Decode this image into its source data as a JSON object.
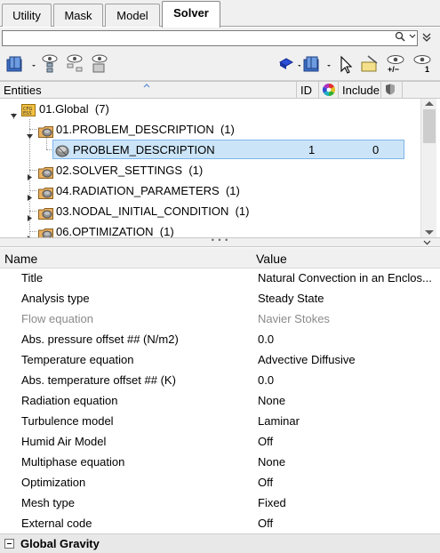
{
  "tabs": [
    {
      "label": "Utility",
      "active": false
    },
    {
      "label": "Mask",
      "active": false
    },
    {
      "label": "Model",
      "active": false
    },
    {
      "label": "Solver",
      "active": true
    }
  ],
  "search": {
    "value": "",
    "placeholder": ""
  },
  "entities_header": {
    "entities": "Entities",
    "id": "ID",
    "include": "Include"
  },
  "tree": [
    {
      "label": "01.Global",
      "count": "(7)",
      "icon": "cfg-folder-icon"
    },
    {
      "label": "01.PROBLEM_DESCRIPTION",
      "count": "(1)",
      "icon": "group-folder-icon"
    },
    {
      "label": "PROBLEM_DESCRIPTION",
      "id": "1",
      "include": "0",
      "icon": "entity-icon",
      "selected": true
    },
    {
      "label": "02.SOLVER_SETTINGS",
      "count": "(1)",
      "icon": "group-folder-icon"
    },
    {
      "label": "04.RADIATION_PARAMETERS",
      "count": "(1)",
      "icon": "group-folder-icon"
    },
    {
      "label": "03.NODAL_INITIAL_CONDITION",
      "count": "(1)",
      "icon": "group-folder-icon"
    },
    {
      "label": "06.OPTIMIZATION",
      "count": "(1)",
      "icon": "group-folder-icon"
    }
  ],
  "properties_header": {
    "name": "Name",
    "value": "Value"
  },
  "properties": [
    {
      "name": "Title",
      "value": "Natural Convection in an Enclos...",
      "dim": false
    },
    {
      "name": "Analysis type",
      "value": "Steady State",
      "dim": false
    },
    {
      "name": "Flow equation",
      "value": "Navier Stokes",
      "dim": true
    },
    {
      "name": "Abs. pressure offset ## (N/m2)",
      "value": "0.0",
      "dim": false
    },
    {
      "name": "Temperature equation",
      "value": "Advective Diffusive",
      "dim": false
    },
    {
      "name": "Abs. temperature offset ## (K)",
      "value": "0.0",
      "dim": false
    },
    {
      "name": "Radiation equation",
      "value": "None",
      "dim": false
    },
    {
      "name": "Turbulence model",
      "value": "Laminar",
      "dim": false
    },
    {
      "name": "Humid Air Model",
      "value": "Off",
      "dim": false
    },
    {
      "name": "Multiphase equation",
      "value": "None",
      "dim": false
    },
    {
      "name": "Optimization",
      "value": "Off",
      "dim": false
    },
    {
      "name": "Mesh type",
      "value": "Fixed",
      "dim": false
    },
    {
      "name": "External code",
      "value": "Off",
      "dim": false
    }
  ],
  "section": {
    "label": "Global Gravity"
  },
  "toolbar_badges": {
    "plus_minus": "+/−",
    "one": "1"
  },
  "colors": {
    "selection": "#cce4f7",
    "selection_border": "#7eb4ea",
    "folder": "#e8b84a",
    "panel": "#f0f0f0"
  }
}
